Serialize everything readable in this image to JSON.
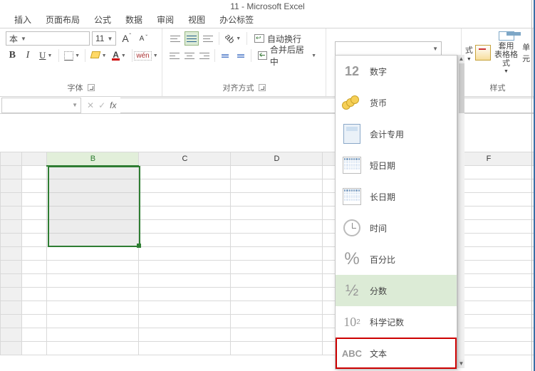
{
  "title": "11 - Microsoft Excel",
  "tabs": [
    "插入",
    "页面布局",
    "公式",
    "数据",
    "审阅",
    "视图",
    "办公标签"
  ],
  "font": {
    "family_suffix": "本",
    "size": "11",
    "bold": "B",
    "italic": "I",
    "underline": "U",
    "grow": "A",
    "shrink": "A",
    "pinyin": "wén",
    "fontcolor": "A",
    "group_label": "字体"
  },
  "align": {
    "wrap_label": "自动换行",
    "merge_label": "合并后居中",
    "group_label": "对齐方式"
  },
  "number": {
    "selected": ""
  },
  "styles": {
    "cond_suffix": "式",
    "table_fmt": "套用\n表格格式",
    "cell_suffix": "单元",
    "group_label": "样式"
  },
  "formula": {
    "namebox": "",
    "cancel": "✕",
    "enter": "✓",
    "fx": "fx",
    "value": ""
  },
  "columns": [
    "",
    "B",
    "C",
    "D",
    "",
    "F"
  ],
  "format_dropdown": [
    {
      "icon": "12",
      "label": "数字"
    },
    {
      "icon": "currency",
      "label": "货币"
    },
    {
      "icon": "calc",
      "label": "会计专用"
    },
    {
      "icon": "cal",
      "label": "短日期"
    },
    {
      "icon": "cal",
      "label": "长日期"
    },
    {
      "icon": "clock",
      "label": "时间"
    },
    {
      "icon": "%",
      "label": "百分比"
    },
    {
      "icon": "½",
      "label": "分数"
    },
    {
      "icon": "10²",
      "label": "科学记数"
    },
    {
      "icon": "ABC",
      "label": "文本"
    }
  ]
}
